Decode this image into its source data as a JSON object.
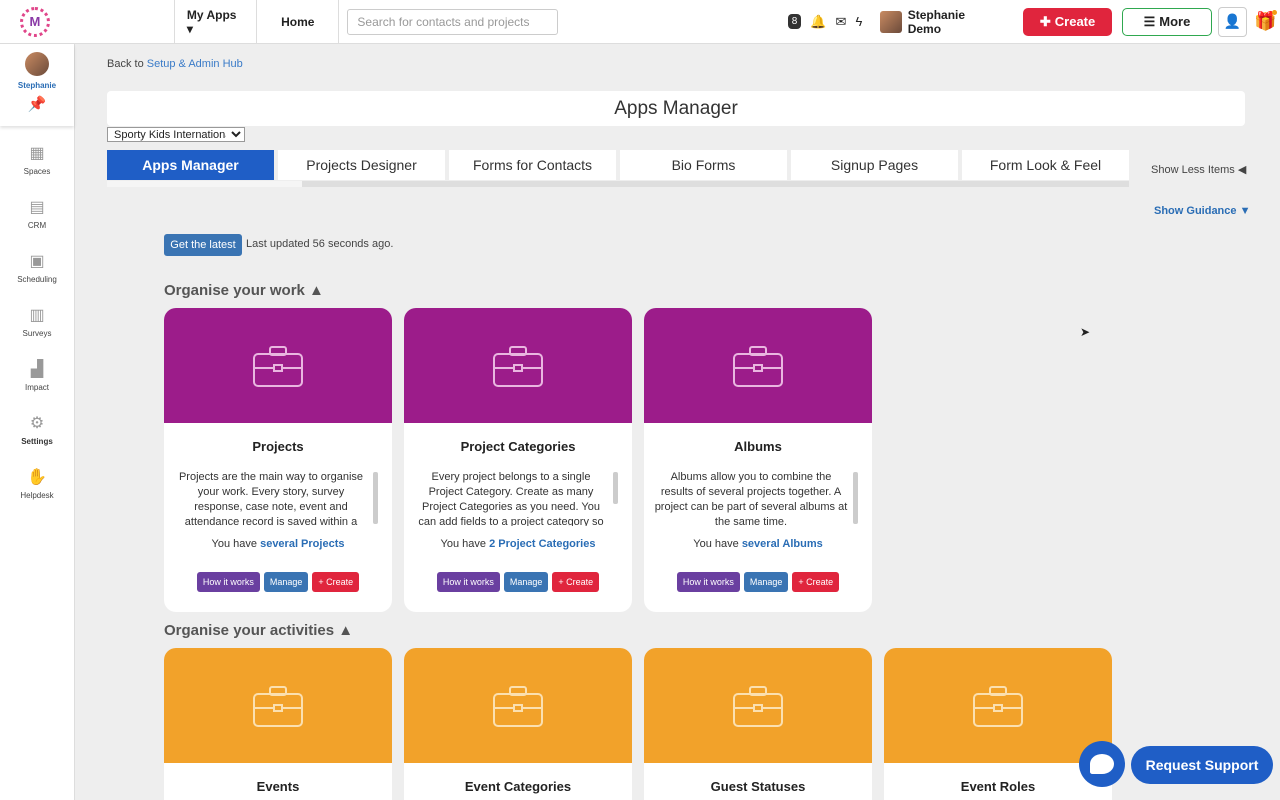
{
  "topbar": {
    "logo_letter": "M",
    "my_apps": "My Apps ▾",
    "home": "Home",
    "search_placeholder": "Search for contacts and projects",
    "notification_count": "8",
    "user_name": "Stephanie Demo",
    "create_label": "Create",
    "more_label": "More"
  },
  "sidebar": {
    "profile_name": "Stephanie",
    "items": [
      {
        "label": "Spaces",
        "icon": "grid-icon"
      },
      {
        "label": "CRM",
        "icon": "contacts-icon"
      },
      {
        "label": "Scheduling",
        "icon": "calendar-icon"
      },
      {
        "label": "Surveys",
        "icon": "clipboard-icon"
      },
      {
        "label": "Impact",
        "icon": "chart-icon"
      },
      {
        "label": "Settings",
        "icon": "gear-icon"
      },
      {
        "label": "Helpdesk",
        "icon": "hand-icon"
      }
    ]
  },
  "breadcrumb": {
    "prefix": "Back to",
    "link": "Setup & Admin Hub"
  },
  "page_title": "Apps Manager",
  "org_select": "Sporty Kids International",
  "tabs": [
    "Apps Manager",
    "Projects Designer",
    "Forms for Contacts",
    "Bio Forms",
    "Signup Pages",
    "Form Look & Feel"
  ],
  "show_less": "Show Less Items ◀",
  "show_guidance": "Show Guidance ▼",
  "get_latest": "Get the latest",
  "last_updated": "Last updated 56 seconds ago.",
  "section1": {
    "title": "Organise your work ▲",
    "cards": [
      {
        "title": "Projects",
        "desc": "Projects are the main way to organise your work. Every story, survey response, case note, event and attendance record is saved within a project",
        "count_prefix": "You have",
        "count_link": "several Projects"
      },
      {
        "title": "Project Categories",
        "desc": "Every project belongs to a single Project Category. Create as many Project Categories as you need. You can add fields to a project category so that",
        "count_prefix": "You have",
        "count_link": "2 Project Categories"
      },
      {
        "title": "Albums",
        "desc": "Albums allow you to combine the results of several projects together. A project can be part of several albums at the same time.",
        "count_prefix": "You have",
        "count_link": "several Albums"
      }
    ]
  },
  "section2": {
    "title": "Organise your activities ▲",
    "cards": [
      {
        "title": "Events"
      },
      {
        "title": "Event Categories"
      },
      {
        "title": "Guest Statuses"
      },
      {
        "title": "Event Roles"
      }
    ]
  },
  "card_buttons": {
    "how": "How it works",
    "manage": "Manage",
    "create": "+ Create"
  },
  "request_support": "Request Support",
  "colors": {
    "primary": "#1f5ec6",
    "purple": "#9c1c8a",
    "orange": "#f2a22a",
    "red": "#e0253d"
  }
}
